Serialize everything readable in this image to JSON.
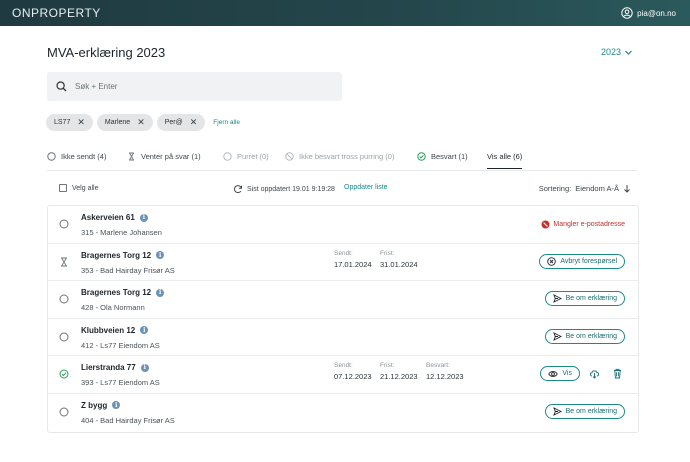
{
  "app": {
    "logo": "ONPROPERTY",
    "user_email": "pia@on.no"
  },
  "page": {
    "title": "MVA-erklæring 2023",
    "year": "2023"
  },
  "search": {
    "placeholder": "Søk + Enter",
    "value": ""
  },
  "filters": {
    "chips": [
      "LS77",
      "Marlene",
      "Per@"
    ],
    "clear_label": "Fjern alle"
  },
  "tabs": [
    {
      "label": "Ikke sendt (4)",
      "icon": "circle-icon"
    },
    {
      "label": "Venter på svar (1)",
      "icon": "hourglass-icon"
    },
    {
      "label": "Purret (0)",
      "icon": "circle-icon"
    },
    {
      "label": "Ikke besvart tross purring (0)",
      "icon": "slashed-circle-icon"
    },
    {
      "label": "Besvart (1)",
      "icon": "check-circle-icon"
    },
    {
      "label": "Vis alle (6)",
      "icon": ""
    }
  ],
  "toolbar": {
    "select_all_label": "Velg alle",
    "last_updated": "Sist oppdatert 19.01 9:19:28",
    "refresh_label": "Oppdater liste",
    "sorting_label": "Sortering:",
    "sorting_value": "Eiendom A-Å"
  },
  "rows": [
    {
      "name": "Askerveien 61",
      "sub": "315 - Marlene Johansen",
      "status": "not-sent",
      "action": {
        "type": "warning",
        "label": "Mangler e-postadresse"
      }
    },
    {
      "name": "Bragernes Torg 12",
      "sub": "353 - Bad Hairday Frisør AS",
      "status": "waiting",
      "dates": [
        {
          "label": "Sendt:",
          "value": "17.01.2024"
        },
        {
          "label": "Frist:",
          "value": "31.01.2024"
        }
      ],
      "action": {
        "type": "button",
        "label": "Avbryt forespørsel",
        "icon": "cancel-circle-icon"
      }
    },
    {
      "name": "Bragernes Torg 12",
      "sub": "428 - Ola Normann",
      "status": "not-sent",
      "action": {
        "type": "button",
        "label": "Be om erklæring",
        "icon": "send-icon"
      }
    },
    {
      "name": "Klubbveien 12",
      "sub": "412 - Ls77 Eiendom AS",
      "status": "not-sent",
      "action": {
        "type": "button",
        "label": "Be om erklæring",
        "icon": "send-icon"
      }
    },
    {
      "name": "Lierstranda 77",
      "sub": "393 - Ls77 Eiendom AS",
      "status": "answered",
      "dates": [
        {
          "label": "Sendt:",
          "value": "07.12.2023"
        },
        {
          "label": "Frist:",
          "value": "21.12.2023"
        },
        {
          "label": "Besvart:",
          "value": "12.12.2023"
        }
      ],
      "action": {
        "type": "button",
        "label": "Vis",
        "icon": "eye-icon"
      }
    },
    {
      "name": "Z bygg",
      "sub": "404 - Bad Hairday Frisør AS",
      "status": "not-sent",
      "action": {
        "type": "button",
        "label": "Be om erklæring",
        "icon": "send-icon"
      }
    }
  ],
  "colors": {
    "accent": "#1a8a8a",
    "header": "#1f3a40",
    "warning": "#c4302b",
    "success": "#2a9d5c"
  }
}
